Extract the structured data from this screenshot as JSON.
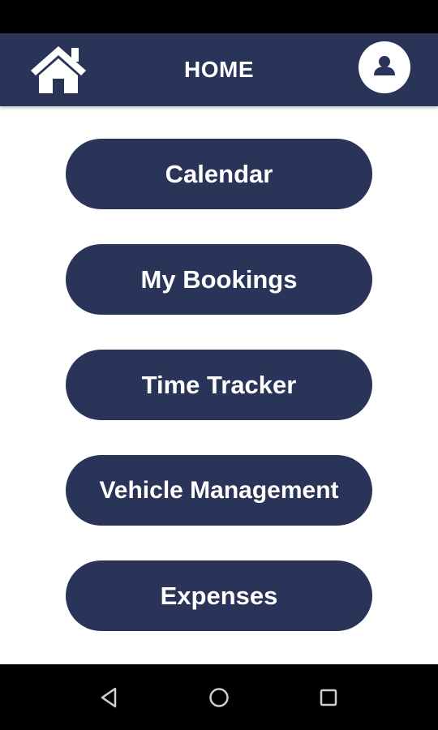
{
  "header": {
    "title": "HOME",
    "left_icon": "home-icon",
    "right_icon": "user-icon"
  },
  "menu": {
    "items": [
      {
        "label": "Calendar"
      },
      {
        "label": "My Bookings"
      },
      {
        "label": "Time Tracker"
      },
      {
        "label": "Vehicle Management"
      },
      {
        "label": "Expenses"
      }
    ]
  },
  "navigation": {
    "buttons": [
      "back-icon",
      "home-circle-icon",
      "recents-icon"
    ]
  },
  "colors": {
    "primary": "#2a3459",
    "on_primary": "#ffffff",
    "background": "#ffffff",
    "system_bars": "#000000"
  }
}
